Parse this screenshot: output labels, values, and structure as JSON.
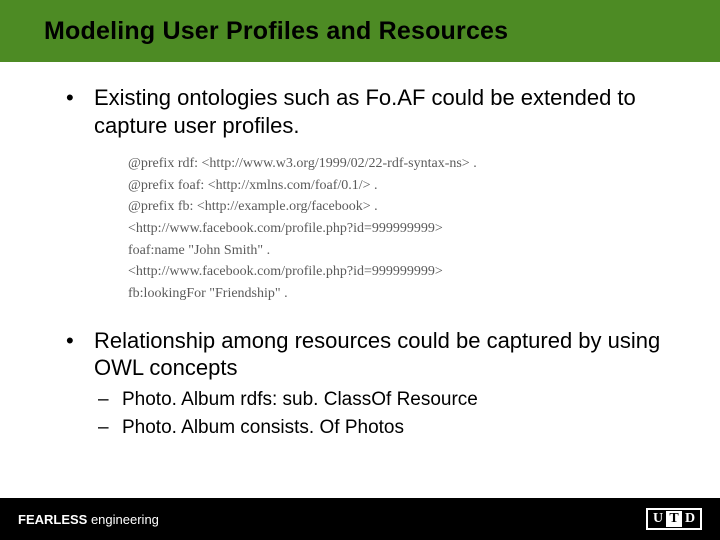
{
  "title": "Modeling User Profiles and Resources",
  "bullets": {
    "b1": "Existing ontologies such as Fo.AF could be extended to capture user profiles.",
    "b2": "Relationship among resources could be captured by using OWL concepts",
    "sub1": "Photo. Album rdfs: sub. ClassOf Resource",
    "sub2": "Photo. Album consists. Of Photos"
  },
  "code": {
    "l1": "@prefix rdf: <http://www.w3.org/1999/02/22-rdf-syntax-ns> .",
    "l2": "@prefix foaf: <http://xmlns.com/foaf/0.1/> .",
    "l3": "@prefix fb: <http://example.org/facebook> .",
    "l4": "<http://www.facebook.com/profile.php?id=999999999>",
    "l5": "foaf:name \"John Smith\" .",
    "l6": "<http://www.facebook.com/profile.php?id=999999999>",
    "l7": "fb:lookingFor \"Friendship\" ."
  },
  "footer": {
    "bold": "FEARLESS",
    "rest": " engineering"
  },
  "logo": {
    "u": "U",
    "t": "T",
    "d": "D"
  }
}
